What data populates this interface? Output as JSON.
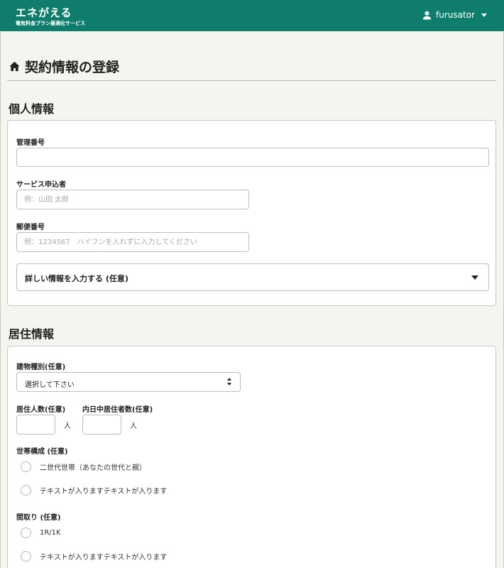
{
  "header": {
    "brand_name": "エネがえる",
    "brand_tagline": "電気料金プラン最適化サービス",
    "username": "furusator",
    "bg_color": "#0f7d6b"
  },
  "page": {
    "title": "契約情報の登録",
    "title_icon": "home-icon"
  },
  "personal": {
    "heading": "個人情報",
    "mgmt_number_label": "管理番号",
    "mgmt_number_value": "",
    "applicant_label": "サービス申込者",
    "applicant_placeholder": "例：山田 太郎",
    "postal_label": "郵便番号",
    "postal_placeholder": "例：1234567　ハイフンを入れずに入力してください",
    "details_toggle_label": "詳しい情報を入力する (任意)"
  },
  "residence": {
    "heading": "居住情報",
    "building_type_label": "建物種別(任意)",
    "building_type_selected": "選択して下さい",
    "residents_label": "居住人数(任意)",
    "residents_unit": "人",
    "daytime_residents_label": "内日中居住者数(任意)",
    "daytime_residents_unit": "人",
    "household_label": "世帯構成 (任意)",
    "household_options": [
      "二世代世帯（あなたの世代と親）",
      "テキストが入りますテキストが入ります"
    ],
    "layout_label": "間取り (任意)",
    "layout_options": [
      "1R/1K",
      "テキストが入りますテキストが入ります"
    ]
  }
}
